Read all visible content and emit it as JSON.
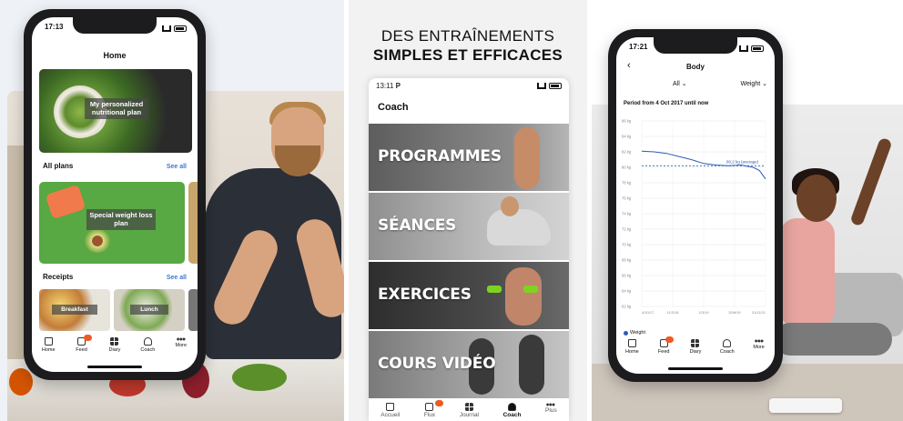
{
  "panel1": {
    "status_time": "17:13",
    "title": "Home",
    "hero_label": "My personalized nutritional plan",
    "all_plans_heading": "All plans",
    "see_all_1": "See all",
    "plan_label": "Special weight loss plan",
    "receipts_heading": "Receipts",
    "see_all_2": "See all",
    "receipt_1": "Breakfast",
    "receipt_2": "Lunch",
    "tabs": [
      {
        "label": "Home",
        "icon": "home-icon"
      },
      {
        "label": "Feed",
        "icon": "feed-icon"
      },
      {
        "label": "Diary",
        "icon": "diary-icon"
      },
      {
        "label": "Coach",
        "icon": "coach-icon"
      },
      {
        "label": "More",
        "icon": "more-icon"
      }
    ]
  },
  "panel2": {
    "headline_line1": "DES ENTRAÎNEMENTS",
    "headline_line2": "SIMPLES ET EFFICACES",
    "status_time": "13:11",
    "status_app": "P",
    "title": "Coach",
    "bands": [
      "PROGRAMMES",
      "SÉANCES",
      "EXERCICES",
      "COURS VIDÉO"
    ],
    "tabs": [
      {
        "label": "Accueil",
        "icon": "home-icon"
      },
      {
        "label": "Flux",
        "icon": "feed-icon"
      },
      {
        "label": "Journal",
        "icon": "journal-icon"
      },
      {
        "label": "Coach",
        "icon": "coach-icon",
        "active": true
      },
      {
        "label": "Plus",
        "icon": "more-icon"
      }
    ]
  },
  "panel3": {
    "status_time": "17:21",
    "title": "Body",
    "filter_left": "All",
    "filter_right": "Weight",
    "period": "Period from 4 Oct 2017 until now",
    "legend": "Weight",
    "tabs": [
      {
        "label": "Home",
        "icon": "home-icon"
      },
      {
        "label": "Feed",
        "icon": "feed-icon"
      },
      {
        "label": "Diary",
        "icon": "diary-icon"
      },
      {
        "label": "Coach",
        "icon": "coach-icon"
      },
      {
        "label": "More",
        "icon": "more-icon"
      }
    ]
  },
  "chart_data": {
    "type": "line",
    "title": "",
    "xlabel": "",
    "ylabel": "",
    "x_ticks": [
      "4/10/17",
      "11/3/18",
      "1/3/19",
      "20/6/19",
      "21/11/21"
    ],
    "y_ticks": [
      "86 kg",
      "84 kg",
      "82 kg",
      "80 kg",
      "78 kg",
      "76 kg",
      "74 kg",
      "72 kg",
      "70 kg",
      "68 kg",
      "66 kg",
      "64 kg",
      "62 kg"
    ],
    "ylim": [
      62,
      86
    ],
    "series": [
      {
        "name": "Weight",
        "color": "#2c5db6",
        "x": [
          0,
          0.1,
          0.2,
          0.3,
          0.4,
          0.5,
          0.6,
          0.7,
          0.8,
          0.9,
          0.95,
          1.0
        ],
        "values": [
          82.1,
          82.0,
          81.8,
          81.4,
          81.0,
          80.5,
          80.3,
          80.2,
          80.3,
          80.0,
          79.6,
          78.5
        ]
      }
    ],
    "average": {
      "label": "80,2 kg (average)",
      "value": 80.2
    },
    "grid": true,
    "legend": "bottom-left"
  }
}
